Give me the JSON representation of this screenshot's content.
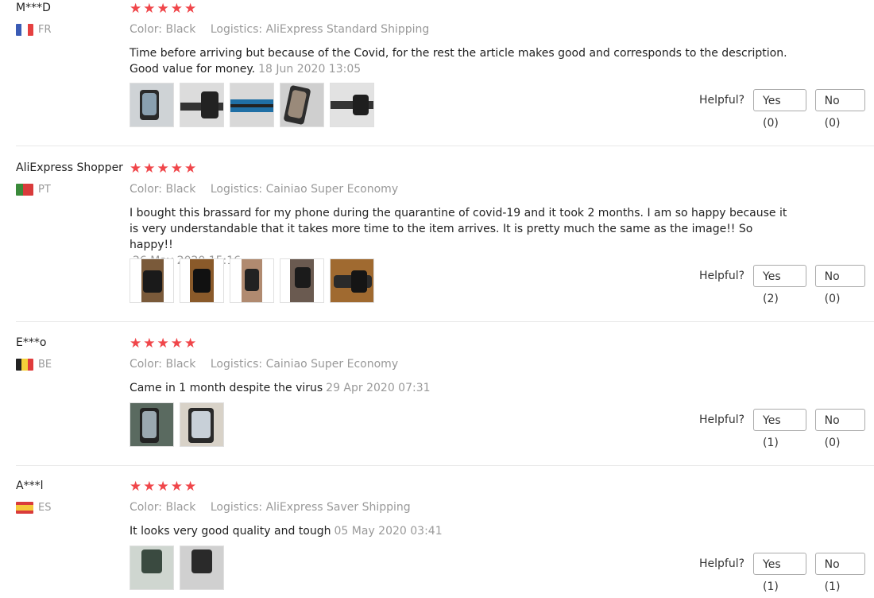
{
  "labels": {
    "color": "Color:",
    "logistics": "Logistics:",
    "helpful": "Helpful?"
  },
  "reviews": [
    {
      "author": "M***D",
      "country": "FR",
      "stars": "★★★★★",
      "rating": 5,
      "color": "Black",
      "logistics": "AliExpress Standard Shipping",
      "text": "Time before arriving but because of the Covid, for the rest the article makes good and corresponds to the description. Good value for money.",
      "date": "18 Jun 2020 13:05",
      "yes": "Yes (0)",
      "no": "No (0)",
      "photos": 5
    },
    {
      "author": "AliExpress Shopper",
      "country": "PT",
      "stars": "★★★★★",
      "rating": 5,
      "color": "Black",
      "logistics": "Cainiao Super Economy",
      "text": "I bought this brassard for my phone during the quarantine of covid-19 and it took 2 months. I am so happy because it is very understandable that it takes more time to the item arrives. It is pretty much the same as the image!! So happy!!",
      "date": "26 May 2020 15:16",
      "yes": "Yes (2)",
      "no": "No (0)",
      "photos": 5
    },
    {
      "author": "E***o",
      "country": "BE",
      "stars": "★★★★★",
      "rating": 5,
      "color": "Black",
      "logistics": "Cainiao Super Economy",
      "text": "Came in 1 month despite the virus",
      "date": "29 Apr 2020 07:31",
      "yes": "Yes (1)",
      "no": "No (0)",
      "photos": 2
    },
    {
      "author": "A***l",
      "country": "ES",
      "stars": "★★★★★",
      "rating": 5,
      "color": "Black",
      "logistics": "AliExpress Saver Shipping",
      "text": "It looks very good quality and tough",
      "date": "05 May 2020 03:41",
      "yes": "Yes (1)",
      "no": "No (1)",
      "photos": 2
    }
  ]
}
